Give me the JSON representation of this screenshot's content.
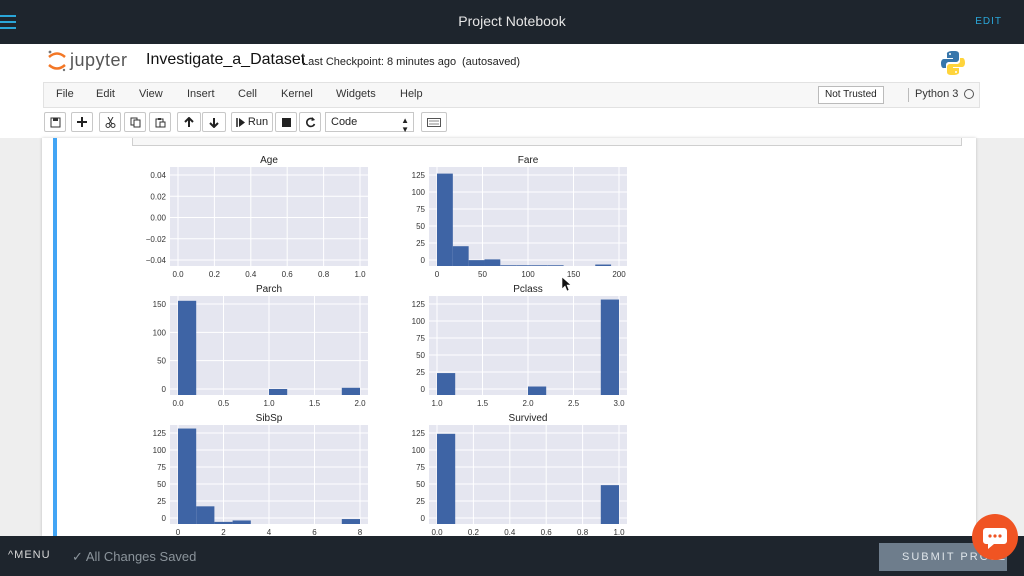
{
  "topbar": {
    "title": "Project Notebook",
    "edit_label": "EDIT"
  },
  "jupyter": {
    "logo_text": "jupyter",
    "notebook_name": "Investigate_a_Dataset",
    "checkpoint": "Last Checkpoint: 8 minutes ago",
    "autosave": "(autosaved)"
  },
  "menu": {
    "items": [
      "File",
      "Edit",
      "View",
      "Insert",
      "Cell",
      "Kernel",
      "Widgets",
      "Help"
    ],
    "trust": "Not Trusted",
    "kernel": "Python 3"
  },
  "toolbar": {
    "run_label": "Run",
    "cell_type": "Code",
    "icons": [
      "save-icon",
      "add-icon",
      "cut-icon",
      "copy-icon",
      "paste-icon",
      "move-up-icon",
      "move-down-icon",
      "run-icon",
      "stop-icon",
      "restart-icon",
      "keyboard-icon"
    ]
  },
  "chart_data": [
    {
      "type": "bar",
      "title": "Age",
      "x_ticks": [
        "0.0",
        "0.2",
        "0.4",
        "0.6",
        "0.8",
        "1.0"
      ],
      "y_ticks": [
        "0.04",
        "0.02",
        "0.00",
        "−0.02",
        "−0.04"
      ],
      "xlim": [
        0,
        1
      ],
      "ylim": [
        -0.05,
        0.05
      ],
      "bins": [],
      "values": []
    },
    {
      "type": "bar",
      "title": "Fare",
      "x_ticks": [
        "0",
        "50",
        "100",
        "150",
        "200"
      ],
      "y_ticks": [
        "125",
        "100",
        "75",
        "50",
        "25",
        "0"
      ],
      "xlim": [
        0,
        230
      ],
      "ylim": [
        0,
        135
      ],
      "bins": [
        [
          0,
          20
        ],
        [
          20,
          40
        ],
        [
          40,
          60
        ],
        [
          60,
          80
        ],
        [
          80,
          100
        ],
        [
          100,
          120
        ],
        [
          120,
          140
        ],
        [
          140,
          160
        ],
        [
          160,
          180
        ],
        [
          200,
          220
        ]
      ],
      "values": [
        126,
        27,
        8,
        9,
        1,
        1,
        1,
        1,
        0,
        2
      ]
    },
    {
      "type": "bar",
      "title": "Parch",
      "x_ticks": [
        "0.0",
        "0.5",
        "1.0",
        "1.5",
        "2.0"
      ],
      "y_ticks": [
        "150",
        "100",
        "50",
        "0"
      ],
      "xlim": [
        0,
        2
      ],
      "ylim": [
        0,
        165
      ],
      "bins": [
        [
          0,
          0.2
        ],
        [
          1.0,
          1.2
        ],
        [
          1.8,
          2.0
        ]
      ],
      "values": [
        157,
        10,
        12
      ]
    },
    {
      "type": "bar",
      "title": "Pclass",
      "x_ticks": [
        "1.0",
        "1.5",
        "2.0",
        "2.5",
        "3.0"
      ],
      "y_ticks": [
        "125",
        "100",
        "75",
        "50",
        "25",
        "0"
      ],
      "xlim": [
        1,
        3
      ],
      "ylim": [
        0,
        140
      ],
      "bins": [
        [
          1.0,
          1.2
        ],
        [
          2.0,
          2.2
        ],
        [
          2.8,
          3.0
        ]
      ],
      "values": [
        31,
        12,
        135
      ]
    },
    {
      "type": "bar",
      "title": "SibSp",
      "x_ticks": [
        "0",
        "2",
        "4",
        "6",
        "8"
      ],
      "y_ticks": [
        "125",
        "100",
        "75",
        "50",
        "25",
        "0"
      ],
      "xlim": [
        0,
        8
      ],
      "ylim": [
        0,
        140
      ],
      "bins": [
        [
          0,
          0.8
        ],
        [
          0.8,
          1.6
        ],
        [
          1.6,
          2.4
        ],
        [
          2.4,
          3.2
        ],
        [
          7.2,
          8.0
        ]
      ],
      "values": [
        135,
        25,
        3,
        5,
        7
      ]
    },
    {
      "type": "bar",
      "title": "Survived",
      "x_ticks": [
        "0.0",
        "0.2",
        "0.4",
        "0.6",
        "0.8",
        "1.0"
      ],
      "y_ticks": [
        "125",
        "100",
        "75",
        "50",
        "25",
        "0"
      ],
      "xlim": [
        0,
        1
      ],
      "ylim": [
        0,
        135
      ],
      "bins": [
        [
          0,
          0.1
        ],
        [
          0.9,
          1.0
        ]
      ],
      "values": [
        123,
        53
      ]
    }
  ],
  "bottombar": {
    "menu_label": "MENU",
    "saved_status": "All Changes Saved",
    "submit_label": "SUBMIT PROJECT"
  },
  "colors": {
    "bar": "#3e64a5",
    "plot_bg": "#e5e6f0",
    "cell_bar": "#42a5f5",
    "chat": "#f05423"
  }
}
